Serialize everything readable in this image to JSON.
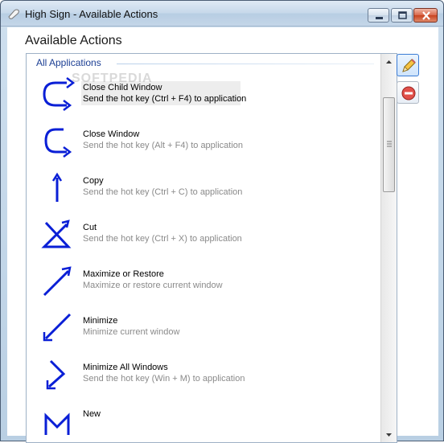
{
  "window": {
    "title": "High Sign - Available Actions"
  },
  "header": {
    "title": "Available Actions"
  },
  "group": {
    "label": "All Applications"
  },
  "watermark": "SOFTPEDIA",
  "actions": [
    {
      "name": "Close Child Window",
      "description": "Send the hot key (Ctrl + F4) to application",
      "gesture": "close-child-window-gesture-icon",
      "selected": true
    },
    {
      "name": "Close Window",
      "description": "Send the hot key (Alt + F4) to application",
      "gesture": "close-window-gesture-icon",
      "selected": false
    },
    {
      "name": "Copy",
      "description": "Send the hot key (Ctrl + C) to application",
      "gesture": "copy-gesture-icon",
      "selected": false
    },
    {
      "name": "Cut",
      "description": "Send the hot key (Ctrl + X) to application",
      "gesture": "cut-gesture-icon",
      "selected": false
    },
    {
      "name": "Maximize or Restore",
      "description": "Maximize or restore current window",
      "gesture": "maximize-gesture-icon",
      "selected": false
    },
    {
      "name": "Minimize",
      "description": "Minimize current window",
      "gesture": "minimize-gesture-icon",
      "selected": false
    },
    {
      "name": "Minimize All Windows",
      "description": "Send the hot key (Win + M) to application",
      "gesture": "minimize-all-gesture-icon",
      "selected": false
    },
    {
      "name": "New",
      "description": "",
      "gesture": "new-gesture-icon",
      "selected": false
    }
  ],
  "colors": {
    "gesture_stroke": "#0a1fd6",
    "group_text": "#1c3f94",
    "description_text": "#8a8a8a"
  }
}
